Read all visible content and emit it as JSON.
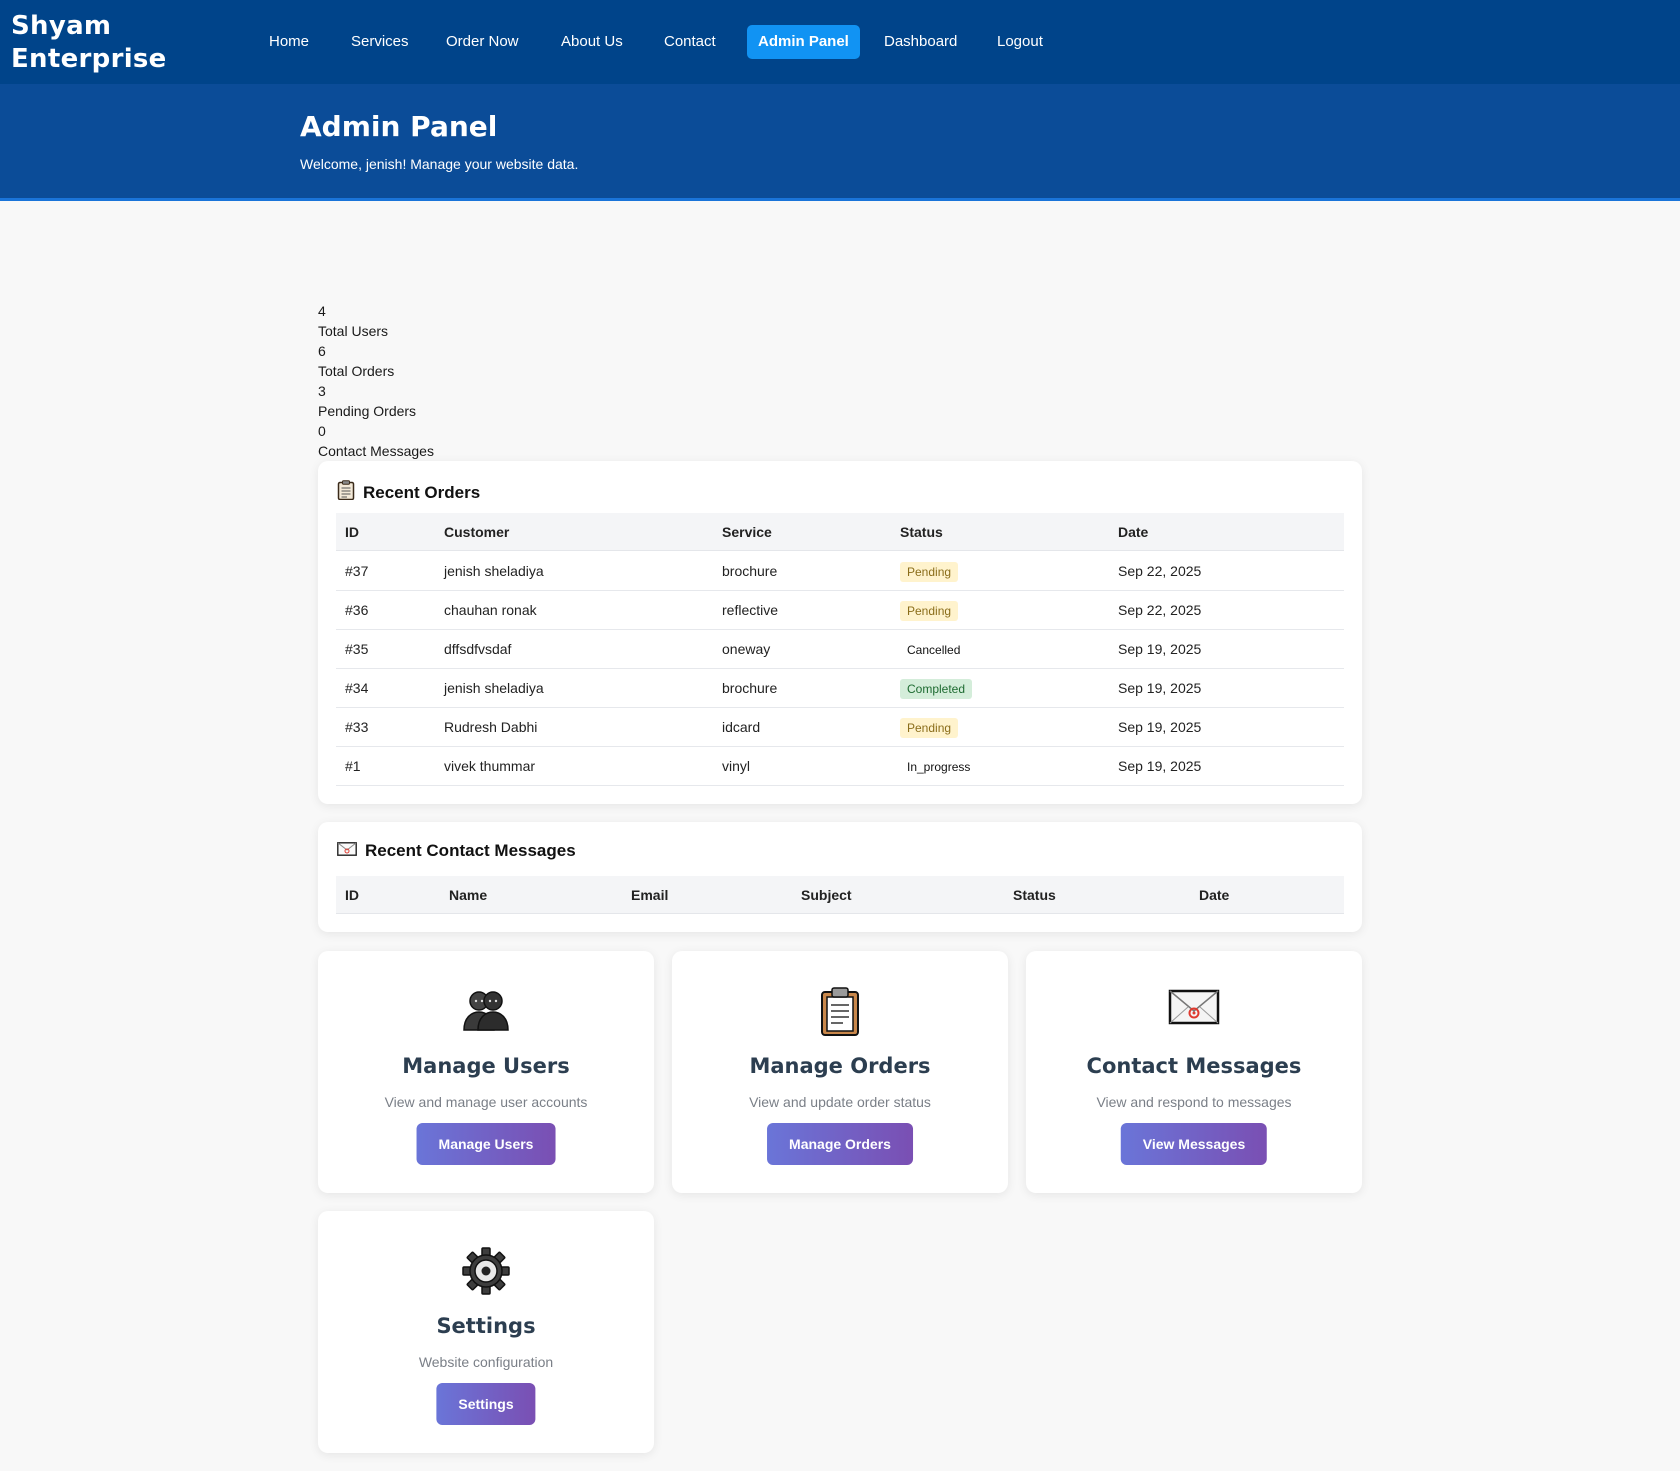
{
  "brand": "Shyam Enterprise",
  "nav": {
    "home": "Home",
    "services": "Services",
    "order_now": "Order Now",
    "about": "About Us",
    "contact": "Contact",
    "admin": "Admin Panel",
    "dashboard": "Dashboard",
    "logout": "Logout"
  },
  "hero": {
    "title": "Admin Panel",
    "subtitle": "Welcome, jenish! Manage your website data."
  },
  "stats": [
    {
      "value": "4",
      "label": "Total Users"
    },
    {
      "value": "6",
      "label": "Total Orders"
    },
    {
      "value": "3",
      "label": "Pending Orders"
    },
    {
      "value": "0",
      "label": "Contact Messages"
    }
  ],
  "recent_orders": {
    "title": "Recent Orders",
    "icon": "clipboard-icon",
    "headers": [
      "ID",
      "Customer",
      "Service",
      "Status",
      "Date"
    ],
    "rows": [
      {
        "id": "#37",
        "customer": "jenish sheladiya",
        "service": "brochure",
        "status": "Pending",
        "date": "Sep 22, 2025"
      },
      {
        "id": "#36",
        "customer": "chauhan ronak",
        "service": "reflective",
        "status": "Pending",
        "date": "Sep 22, 2025"
      },
      {
        "id": "#35",
        "customer": "dffsdfvsdaf",
        "service": "oneway",
        "status": "Cancelled",
        "date": "Sep 19, 2025"
      },
      {
        "id": "#34",
        "customer": "jenish sheladiya",
        "service": "brochure",
        "status": "Completed",
        "date": "Sep 19, 2025"
      },
      {
        "id": "#33",
        "customer": "Rudresh Dabhi",
        "service": "idcard",
        "status": "Pending",
        "date": "Sep 19, 2025"
      },
      {
        "id": "#1",
        "customer": "vivek thummar",
        "service": "vinyl",
        "status": "In_progress",
        "date": "Sep 19, 2025"
      }
    ]
  },
  "recent_messages": {
    "title": "Recent Contact Messages",
    "icon": "envelope-icon",
    "headers": [
      "ID",
      "Name",
      "Email",
      "Subject",
      "Status",
      "Date"
    ]
  },
  "actions": {
    "users": {
      "title": "Manage Users",
      "desc": "View and manage user accounts",
      "button": "Manage Users",
      "icon": "users-icon"
    },
    "orders": {
      "title": "Manage Orders",
      "desc": "View and update order status",
      "button": "Manage Orders",
      "icon": "clipboard-icon"
    },
    "messages": {
      "title": "Contact Messages",
      "desc": "View and respond to messages",
      "button": "View Messages",
      "icon": "envelope-icon"
    },
    "settings": {
      "title": "Settings",
      "desc": "Website configuration",
      "button": "Settings",
      "icon": "gear-icon"
    }
  },
  "colors": {
    "navbar": "#00448a",
    "hero": "#0b4c98",
    "nav_active": "#1193f3",
    "button_gradient_start": "#6a75d8",
    "button_gradient_end": "#7a4fb3",
    "badge_pending": "#fff3cd",
    "badge_completed": "#d4edda"
  }
}
